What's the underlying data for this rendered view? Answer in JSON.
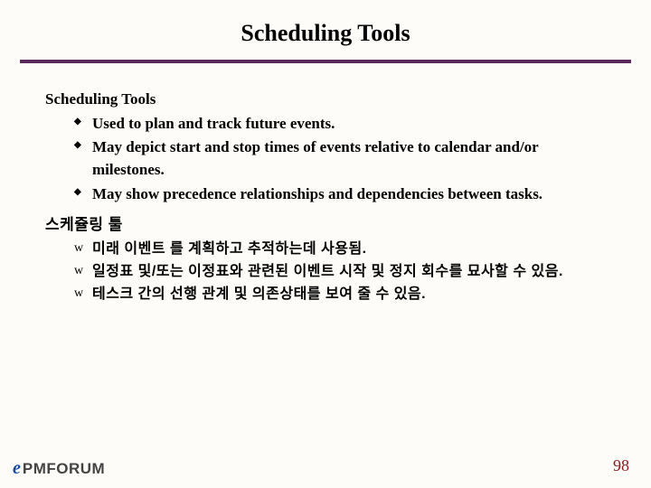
{
  "title": "Scheduling Tools",
  "section_en": {
    "heading": "Scheduling Tools",
    "bullets": [
      "Used to plan and track future events.",
      "May depict start and stop times of events relative to calendar and/or milestones.",
      "May show precedence relationships and dependencies between tasks."
    ]
  },
  "section_kr": {
    "heading": "스케쥴링 툴",
    "bullets": [
      "미래 이벤트 를 계획하고 추적하는데 사용됨.",
      "일정표 및/또는 이정표와 관련된 이벤트 시작 및 정지 회수를 묘사할 수 있음.",
      "테스크 간의 선행 관계 및 의존상태를 보여 줄 수 있음."
    ]
  },
  "footer": {
    "logo_e": "e",
    "logo_text": "PMFORUM",
    "page_number": "98"
  }
}
